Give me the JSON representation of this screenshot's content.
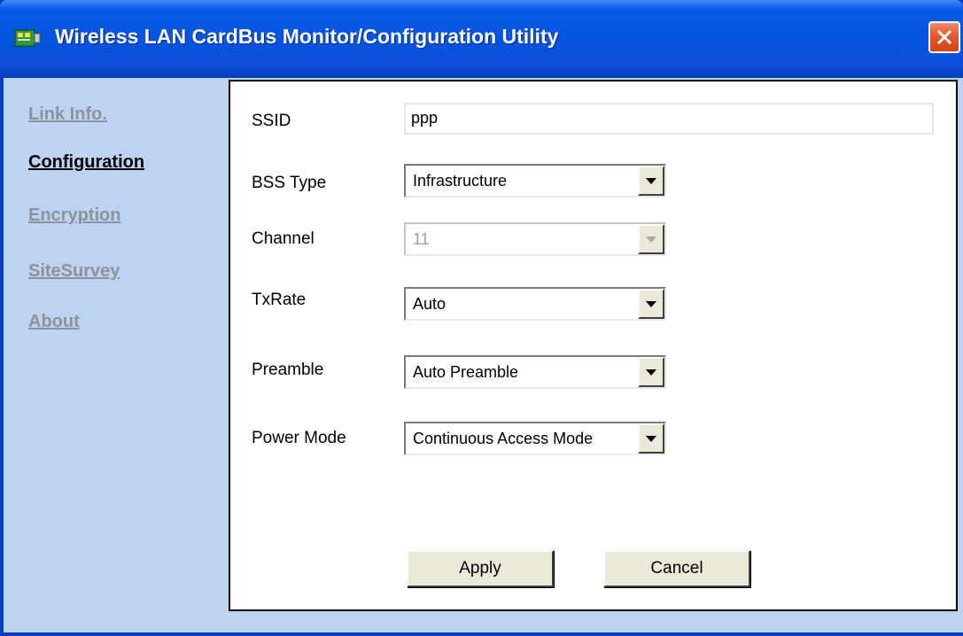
{
  "window": {
    "title": "Wireless LAN CardBus Monitor/Configuration Utility"
  },
  "nav": {
    "items": [
      {
        "label": "Link Info.",
        "active": false
      },
      {
        "label": "Configuration",
        "active": true
      },
      {
        "label": "Encryption",
        "active": false
      },
      {
        "label": "SiteSurvey",
        "active": false
      },
      {
        "label": "About",
        "active": false
      }
    ]
  },
  "form": {
    "ssid_label": "SSID",
    "ssid_value": "ppp",
    "bss_type_label": "BSS Type",
    "bss_type_value": "Infrastructure",
    "channel_label": "Channel",
    "channel_value": "11",
    "txrate_label": "TxRate",
    "txrate_value": "Auto",
    "preamble_label": "Preamble",
    "preamble_value": "Auto Preamble",
    "power_mode_label": "Power Mode",
    "power_mode_value": "Continuous Access Mode"
  },
  "buttons": {
    "apply_label": "Apply",
    "cancel_label": "Cancel"
  },
  "colors": {
    "titlebar": "#0553e0",
    "client_background": "#bcd3f2",
    "nav_inactive": "#8c939a",
    "nav_active": "#000000",
    "close_button": "#e3572f"
  }
}
